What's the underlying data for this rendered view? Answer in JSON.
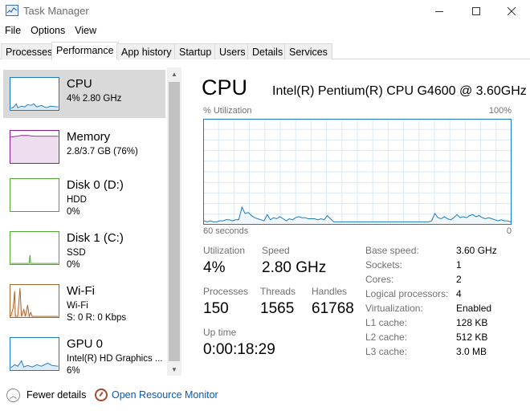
{
  "window": {
    "title": "Task Manager",
    "minimize_icon": "minimize-icon",
    "maximize_icon": "maximize-icon",
    "close_icon": "close-icon"
  },
  "menu": [
    "File",
    "Options",
    "View"
  ],
  "tabs": [
    "Processes",
    "Performance",
    "App history",
    "Startup",
    "Users",
    "Details",
    "Services"
  ],
  "active_tab": "Performance",
  "sidebar": {
    "items": [
      {
        "name": "CPU",
        "line1": "4% 2.80 GHz",
        "line2": "",
        "color": "#1a7bc4",
        "selected": true
      },
      {
        "name": "Memory",
        "line1": "2.8/3.7 GB (76%)",
        "line2": "",
        "color": "#8b1b94",
        "selected": false
      },
      {
        "name": "Disk 0 (D:)",
        "line1": "HDD",
        "line2": "0%",
        "color": "#4ea72e",
        "selected": false
      },
      {
        "name": "Disk 1 (C:)",
        "line1": "SSD",
        "line2": "0%",
        "color": "#4ea72e",
        "selected": false
      },
      {
        "name": "Wi-Fi",
        "line1": "Wi-Fi",
        "line2": "S: 0 R: 0 Kbps",
        "color": "#a8632a",
        "selected": false
      },
      {
        "name": "GPU 0",
        "line1": "Intel(R) HD Graphics ...",
        "line2": "6%",
        "color": "#1a7bc4",
        "selected": false
      }
    ]
  },
  "cpu": {
    "title": "CPU",
    "model": "Intel(R) Pentium(R) CPU G4600 @ 3.60GHz",
    "util_label": "% Utilization",
    "util_max": "100%",
    "axis_left": "60 seconds",
    "axis_right": "0",
    "graph_color": "#1a7bc4",
    "utilization_history": [
      3,
      2,
      3,
      2,
      2,
      3,
      3,
      4,
      4,
      3,
      4,
      4,
      16,
      10,
      11,
      8,
      6,
      5,
      4,
      3,
      9,
      4,
      6,
      5,
      7,
      5,
      3,
      5,
      4,
      6,
      7,
      6,
      6,
      5,
      5,
      5,
      4,
      5,
      4,
      8,
      5,
      2,
      2,
      2,
      2,
      2,
      2,
      2,
      2,
      2,
      2,
      2,
      2,
      2,
      2,
      2,
      2,
      2,
      2,
      2,
      2,
      2,
      2,
      2,
      2,
      2,
      2,
      2,
      2,
      2,
      2,
      2,
      3,
      10,
      6,
      5,
      7,
      5,
      4,
      6,
      9,
      6,
      7,
      6,
      8,
      9,
      7,
      8,
      6,
      5,
      6,
      5,
      4,
      3,
      4,
      3,
      3,
      2
    ],
    "stats": {
      "utilization_label": "Utilization",
      "utilization": "4%",
      "speed_label": "Speed",
      "speed": "2.80 GHz",
      "processes_label": "Processes",
      "processes": "150",
      "threads_label": "Threads",
      "threads": "1565",
      "handles_label": "Handles",
      "handles": "61768",
      "uptime_label": "Up time",
      "uptime": "0:00:18:29"
    },
    "specs": [
      {
        "key": "Base speed:",
        "value": "3.60 GHz"
      },
      {
        "key": "Sockets:",
        "value": "1"
      },
      {
        "key": "Cores:",
        "value": "2"
      },
      {
        "key": "Logical processors:",
        "value": "4"
      },
      {
        "key": "Virtualization:",
        "value": "Enabled"
      },
      {
        "key": "L1 cache:",
        "value": "128 KB"
      },
      {
        "key": "L2 cache:",
        "value": "512 KB"
      },
      {
        "key": "L3 cache:",
        "value": "3.0 MB"
      }
    ]
  },
  "footer": {
    "fewer_details": "Fewer details",
    "open_resource_monitor": "Open Resource Monitor"
  }
}
